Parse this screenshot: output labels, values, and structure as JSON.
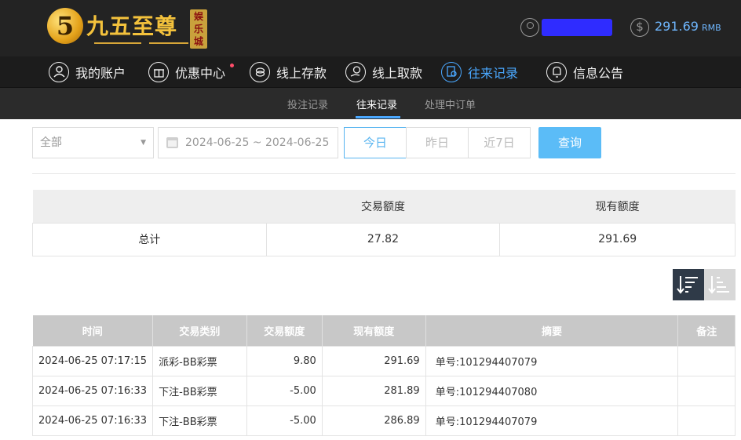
{
  "brand": {
    "mark": "5",
    "name": "九五至尊",
    "seal": [
      "娱",
      "乐",
      "城"
    ]
  },
  "account": {
    "username_masked": "·····",
    "currency_symbol": "$",
    "balance": "291.69",
    "currency": "RMB"
  },
  "main_nav": [
    {
      "label": "我的账户",
      "icon": "user-circle-icon"
    },
    {
      "label": "优惠中心",
      "icon": "gift-icon",
      "has_dot": true
    },
    {
      "label": "线上存款",
      "icon": "deposit-coins-icon"
    },
    {
      "label": "线上取款",
      "icon": "withdraw-hand-icon"
    },
    {
      "label": "往来记录",
      "icon": "records-search-icon",
      "active": true
    },
    {
      "label": "信息公告",
      "icon": "bell-icon"
    }
  ],
  "sub_nav": [
    {
      "label": "投注记录"
    },
    {
      "label": "往来记录",
      "active": true
    },
    {
      "label": "处理中订单"
    }
  ],
  "filters": {
    "type_select": "全部",
    "date_range": "2024-06-25 ~ 2024-06-25",
    "quick_ranges": [
      "今日",
      "昨日",
      "近7日"
    ],
    "query_button": "查询"
  },
  "summary": {
    "headers": [
      "",
      "交易额度",
      "现有额度"
    ],
    "row": {
      "label": "总计",
      "amount": "27.82",
      "balance": "291.69"
    }
  },
  "records": {
    "headers": [
      "时间",
      "交易类别",
      "交易额度",
      "现有额度",
      "摘要",
      "备注"
    ],
    "rows": [
      {
        "time": "2024-06-25 07:17:15",
        "category": "派彩-BB彩票",
        "amount": "9.80",
        "balance": "291.69",
        "summary": "单号:101294407079",
        "remark": ""
      },
      {
        "time": "2024-06-25 07:16:33",
        "category": "下注-BB彩票",
        "amount": "-5.00",
        "balance": "281.89",
        "summary": "单号:101294407080",
        "remark": ""
      },
      {
        "time": "2024-06-25 07:16:33",
        "category": "下注-BB彩票",
        "amount": "-5.00",
        "balance": "286.89",
        "summary": "单号:101294407079",
        "remark": ""
      }
    ]
  },
  "colors": {
    "header_bg": "#232323",
    "accent_blue": "#4aa8ff",
    "button_blue": "#5bbcf7",
    "table_header_bg": "#c8c8c8"
  }
}
